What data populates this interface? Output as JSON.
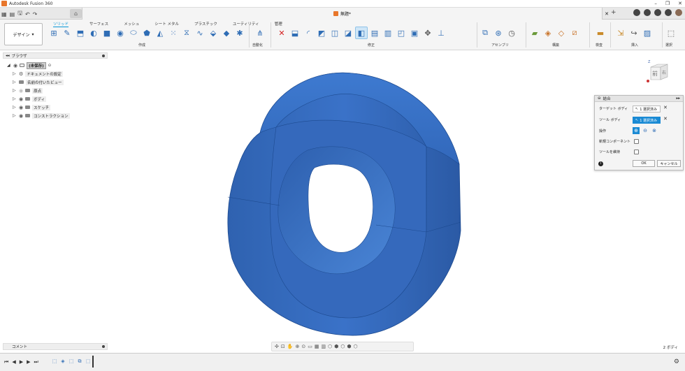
{
  "title_bar": {
    "app_title": "Autodesk Fusion 360"
  },
  "document_tab": {
    "name": "無題*"
  },
  "workspace": {
    "label": "デザイン"
  },
  "ribbon": {
    "tabs": [
      "ソリッド",
      "サーフェス",
      "メッシュ",
      "シート メタル",
      "プラスチック",
      "ユーティリティ",
      "管理"
    ],
    "active_tab": "ソリッド",
    "groups": [
      "作成",
      "自動化",
      "修正",
      "アセンブリ",
      "構築",
      "検査",
      "挿入",
      "選択"
    ]
  },
  "browser": {
    "header": "ブラウザ",
    "items": [
      {
        "label": "(未保存)"
      },
      {
        "label": "ドキュメントの設定"
      },
      {
        "label": "名前の付いたビュー"
      },
      {
        "label": "原点"
      },
      {
        "label": "ボディ"
      },
      {
        "label": "スケッチ"
      },
      {
        "label": "コンストラクション"
      }
    ]
  },
  "viewcube": {
    "front": "前",
    "right": "右",
    "z": "Z"
  },
  "combine_dialog": {
    "title": "結合",
    "target_body_label": "ターゲット ボディ",
    "target_body_value": "1 選択済み",
    "tool_body_label": "ツール ボディ",
    "tool_body_value": "1 選択済み",
    "operation_label": "操作",
    "new_component_label": "新規コンポーネント",
    "keep_tools_label": "ツールを維持",
    "ok_label": "OK",
    "cancel_label": "キャンセル"
  },
  "comments": {
    "label": "コメント"
  },
  "status": {
    "bodies": "2 ボディ"
  },
  "colors": {
    "accent": "#0696d7",
    "model": "#3a6fc4",
    "cancel": "#d42020"
  }
}
